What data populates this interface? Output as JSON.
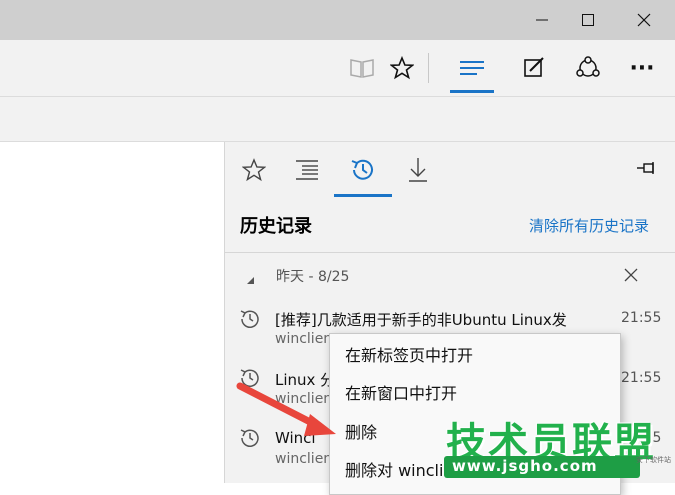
{
  "window": {
    "minimize_icon": "minimize-icon",
    "maximize_icon": "maximize-icon",
    "close_icon": "close-icon"
  },
  "toolbar": {
    "icons": [
      "reading-view-icon",
      "favorite-star-icon",
      "hub-icon",
      "web-note-icon",
      "share-icon",
      "more-icon"
    ],
    "more_label": "···"
  },
  "hub": {
    "tabs": [
      "favorites-tab",
      "reading-list-tab",
      "history-tab",
      "downloads-tab"
    ],
    "title": "历史记录",
    "clear_all": "清除所有历史记录",
    "group": {
      "label": "昨天 - 8/25"
    },
    "items": [
      {
        "title": "[推荐]几款适用于新手的非Ubuntu Linux发",
        "subtitle": "winclien",
        "time": "21:55"
      },
      {
        "title": "Linux 分",
        "subtitle": "winclien",
        "time": "21:55"
      },
      {
        "title": "Wincl",
        "subtitle": "winclien",
        "time": "21:55"
      }
    ]
  },
  "context_menu": {
    "items": [
      "在新标签页中打开",
      "在新窗口中打开",
      "删除",
      "删除对 winclie"
    ]
  },
  "watermark": {
    "title": "技术员联盟",
    "url": "www.jsgho.com",
    "small": "安下软件站"
  },
  "colors": {
    "accent": "#1a74c7",
    "titlebar": "#cfcfcf",
    "pane": "#f2f2f2",
    "arrow": "#e8463c",
    "watermark": "#22b14c"
  }
}
